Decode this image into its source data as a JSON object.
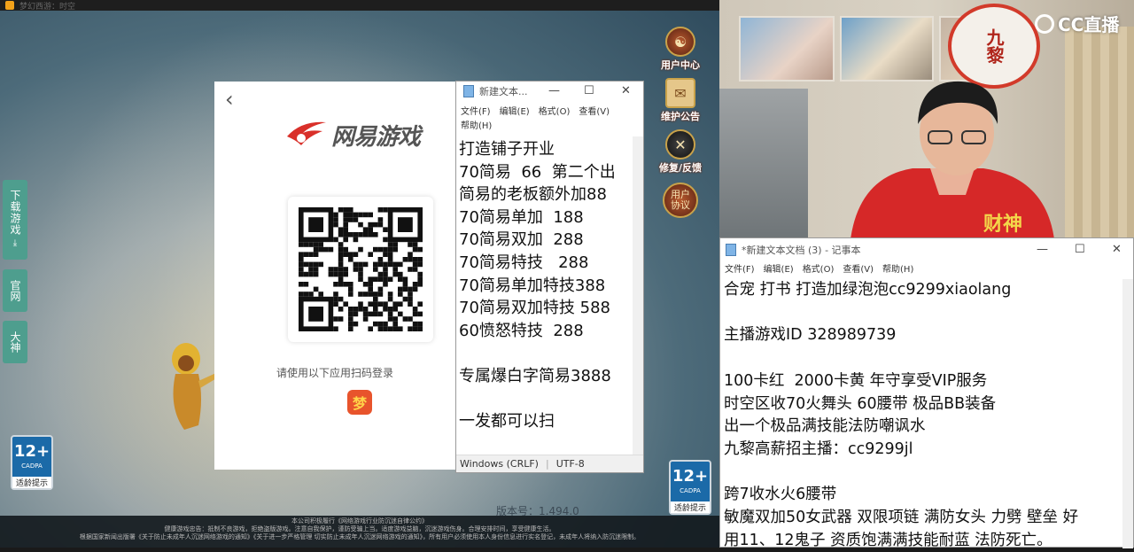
{
  "game": {
    "window_title": "梦幻西游：时空",
    "left_tabs": [
      {
        "label": "下载游戏"
      },
      {
        "label": "官网"
      },
      {
        "label": "大神"
      }
    ],
    "right_menu": [
      {
        "label": "用户中心"
      },
      {
        "label": "维护公告"
      },
      {
        "label": "修复/反馈"
      },
      {
        "label": "用户协议"
      }
    ],
    "age_badge": {
      "num": "12+",
      "org": "CADPA",
      "tip": "适龄提示"
    },
    "version_text": "版本号：1.494.0",
    "footer_lines": [
      "本公司积极履行《网络游戏行业防沉迷自律公约》",
      "健康游戏忠告：抵制不良游戏，拒绝盗版游戏。注意自我保护，谨防受骗上当。适度游戏益脑，沉迷游戏伤身。合理安排时间，享受健康生活。",
      "根据国家新闻出版署《关于防止未成年人沉迷网络游戏的通知》《关于进一步严格管理 切实防止未成年人沉迷网络游戏的通知》，所有用户必须使用本人身份信息进行实名登记，未成年人将纳入防沉迷限制。"
    ]
  },
  "login": {
    "logo_text": "网易游戏",
    "hint": "请使用以下应用扫码登录"
  },
  "notepad_small": {
    "title": "新建文本...",
    "menu": [
      "文件(F)",
      "编辑(E)",
      "格式(O)",
      "查看(V)",
      "帮助(H)"
    ],
    "content": "打造铺子开业\n70简易  66  第二个出\n简易的老板额外加88\n70简易单加  188\n70简易双加  288\n70简易特技   288\n70简易单加特技388\n70简易双加特技 588\n60愤怒特技  288\n\n专属爆白字简易3888\n\n一发都可以扫",
    "status_encoding_line": "Windows (CRLF)",
    "status_charset": "UTF-8"
  },
  "webcam": {
    "brand": "CC直播",
    "lantern_text": "九黎"
  },
  "notepad_big": {
    "title": "*新建文本文档 (3) - 记事本",
    "menu": [
      "文件(F)",
      "编辑(E)",
      "格式(O)",
      "查看(V)",
      "帮助(H)"
    ],
    "content": "合宠 打书 打造加绿泡泡cc9299xiaolang\n\n主播游戏ID 328989739\n\n100卡红  2000卡黄 年守享受VIP服务\n时空区收70火舞头 60腰带 极品BB装备\n出一个极品满技能法防嘲讽水\n九黎高薪招主播：cc9299jl\n\n跨7收水火6腰带\n敏魔双加50女武器 双限项链 满防女头 力劈 壁垒 好\n用11、12鬼子 资质饱满满技能耐蓝 法防死亡。"
  }
}
